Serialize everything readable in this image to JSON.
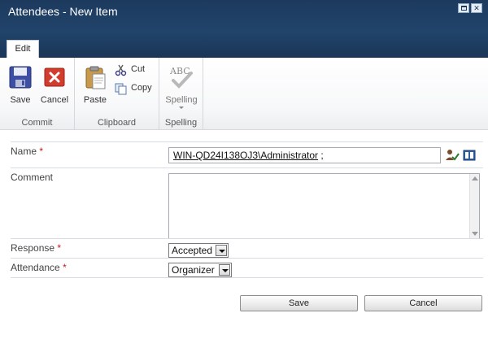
{
  "window": {
    "title": "Attendees - New Item",
    "maximize_icon": "maximize-icon",
    "close_icon": "close-icon"
  },
  "ribbon": {
    "tab_label": "Edit",
    "groups": {
      "commit": {
        "label": "Commit",
        "save_label": "Save",
        "cancel_label": "Cancel"
      },
      "clipboard": {
        "label": "Clipboard",
        "paste_label": "Paste",
        "cut_label": "Cut",
        "copy_label": "Copy"
      },
      "spelling": {
        "label": "Spelling",
        "spelling_label": "Spelling",
        "icon_text": "ABC"
      }
    }
  },
  "form": {
    "required_marker": "*",
    "fields": {
      "name": {
        "label": "Name",
        "value": "WIN-QD24I138OJ3\\Administrator",
        "suffix": " ;"
      },
      "comment": {
        "label": "Comment",
        "value": ""
      },
      "response": {
        "label": "Response",
        "value": "Accepted"
      },
      "attendance": {
        "label": "Attendance",
        "value": "Organizer"
      }
    },
    "save_button": "Save",
    "cancel_button": "Cancel"
  },
  "colors": {
    "title_bar": "#21446b",
    "required": "#c41a1a",
    "ribbon_bg": "#f7f8f9"
  }
}
